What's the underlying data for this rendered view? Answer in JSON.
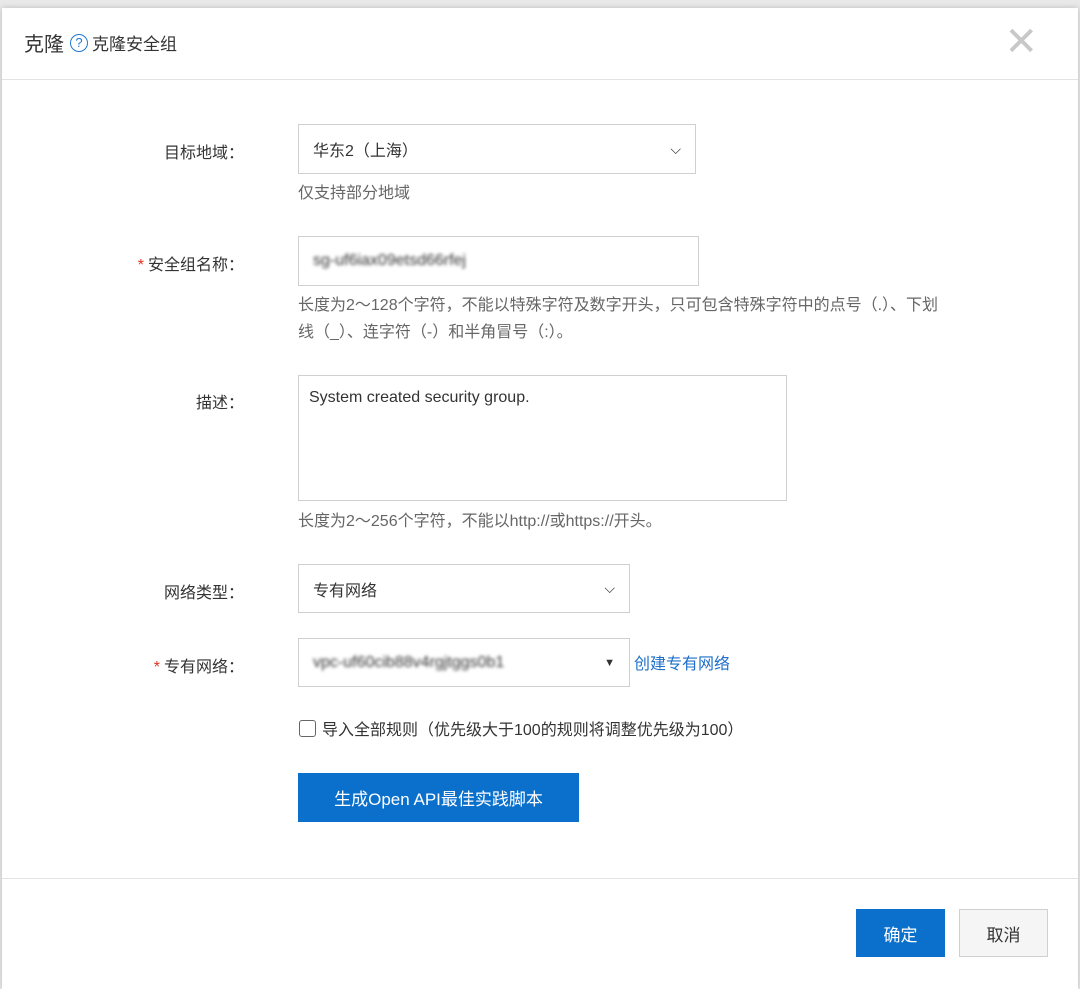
{
  "header": {
    "title": "克隆",
    "subtitle": "克隆安全组",
    "help_icon": "?",
    "close": "✕"
  },
  "form": {
    "region": {
      "label": "目标地域：",
      "value": "华东2（上海）",
      "hint": "仅支持部分地域"
    },
    "name": {
      "label": "安全组名称：",
      "required": "*",
      "value": "sg-uf6iax09etsd66rfej",
      "hint_line1": "长度为2～128个字符，不能以特殊字符及数字开头，只可包含特殊字符中的点号（.）、下划",
      "hint_line2": "线（_）、连字符（-）和半角冒号（:）。"
    },
    "description": {
      "label": "描述：",
      "value": "System created security group.",
      "hint": "长度为2～256个字符，不能以http://或https://开头。"
    },
    "network_type": {
      "label": "网络类型：",
      "value": "专有网络"
    },
    "vpc": {
      "label": "专有网络：",
      "required": "*",
      "value": "vpc-uf60cib88v4rgjtggs0b1",
      "create_link": "创建专有网络"
    },
    "import_rules": {
      "label": "导入全部规则（优先级大于100的规则将调整优先级为100）",
      "checked": false
    },
    "generate_button": "生成Open API最佳实践脚本"
  },
  "footer": {
    "ok": "确定",
    "cancel": "取消"
  }
}
